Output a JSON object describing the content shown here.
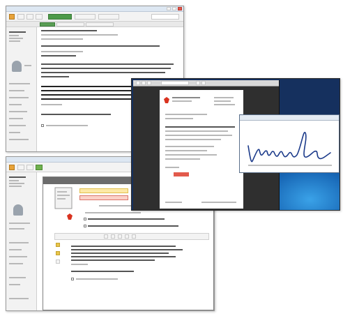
{
  "colors": {
    "brand_red": "#d9321f",
    "signature_ink": "#1b3a8a",
    "desktop_blue": "#1766b5",
    "notice_yellow": "#fde9a6",
    "notice_red": "#fbd1c8"
  },
  "icons": [
    "app-logo-icon",
    "user-avatar-icon",
    "document-icon",
    "brand-logo-icon",
    "checkbox-icon"
  ]
}
